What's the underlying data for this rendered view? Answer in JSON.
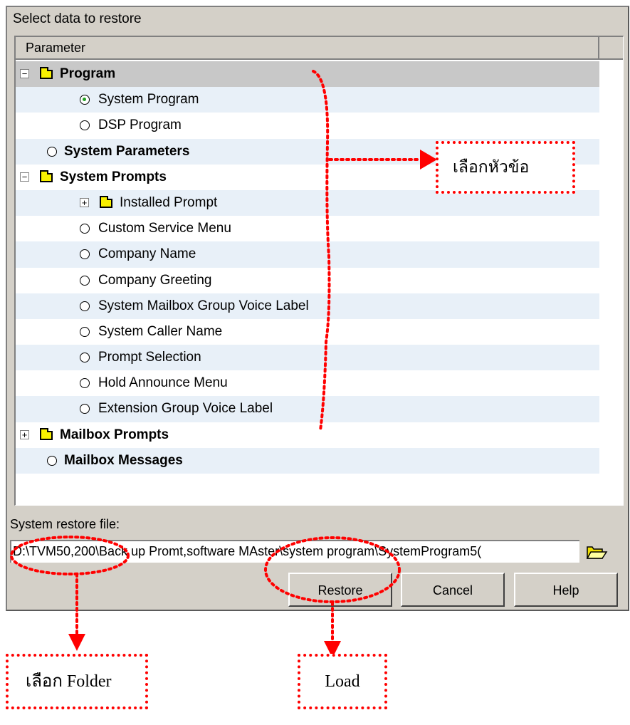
{
  "dialog": {
    "title": "Select data to restore",
    "column_header": "Parameter",
    "tree": [
      {
        "label": "Program",
        "type": "folder",
        "expander": "−",
        "bold": true,
        "level": 0,
        "selected": true
      },
      {
        "label": "System Program",
        "type": "radio",
        "checked": true,
        "bold": false,
        "level": 1
      },
      {
        "label": "DSP Program",
        "type": "radio",
        "checked": false,
        "bold": false,
        "level": 1
      },
      {
        "label": "System Parameters",
        "type": "radio",
        "checked": false,
        "bold": true,
        "level": 0
      },
      {
        "label": "System Prompts",
        "type": "folder",
        "expander": "−",
        "bold": true,
        "level": 0
      },
      {
        "label": "Installed Prompt",
        "type": "folder",
        "expander": "+",
        "bold": false,
        "level": 1
      },
      {
        "label": "Custom Service Menu",
        "type": "radio",
        "checked": false,
        "bold": false,
        "level": 1
      },
      {
        "label": "Company Name",
        "type": "radio",
        "checked": false,
        "bold": false,
        "level": 1
      },
      {
        "label": "Company Greeting",
        "type": "radio",
        "checked": false,
        "bold": false,
        "level": 1
      },
      {
        "label": "System Mailbox Group Voice Label",
        "type": "radio",
        "checked": false,
        "bold": false,
        "level": 1
      },
      {
        "label": "System Caller Name",
        "type": "radio",
        "checked": false,
        "bold": false,
        "level": 1
      },
      {
        "label": "Prompt Selection",
        "type": "radio",
        "checked": false,
        "bold": false,
        "level": 1
      },
      {
        "label": "Hold Announce Menu",
        "type": "radio",
        "checked": false,
        "bold": false,
        "level": 1
      },
      {
        "label": "Extension Group Voice Label",
        "type": "radio",
        "checked": false,
        "bold": false,
        "level": 1
      },
      {
        "label": "Mailbox Prompts",
        "type": "folder",
        "expander": "+",
        "bold": true,
        "level": 0
      },
      {
        "label": "Mailbox Messages",
        "type": "radio",
        "checked": false,
        "bold": true,
        "level": 0
      }
    ],
    "restore_file_label": "System restore file:",
    "restore_file_value": "D:\\TVM50,200\\Back up Promt,software MAster\\system program\\SystemProgram5(",
    "buttons": {
      "restore": "Restore",
      "cancel": "Cancel",
      "help": "Help"
    }
  },
  "annotations": {
    "select_topic": "เลือกหัวข้อ",
    "select_folder": "เลือก Folder",
    "load": "Load"
  },
  "colors": {
    "annotation": "#ff0000",
    "dialog_bg": "#d4d0c8",
    "alt_row": "#e8f0f8",
    "folder": "#f8f000"
  }
}
